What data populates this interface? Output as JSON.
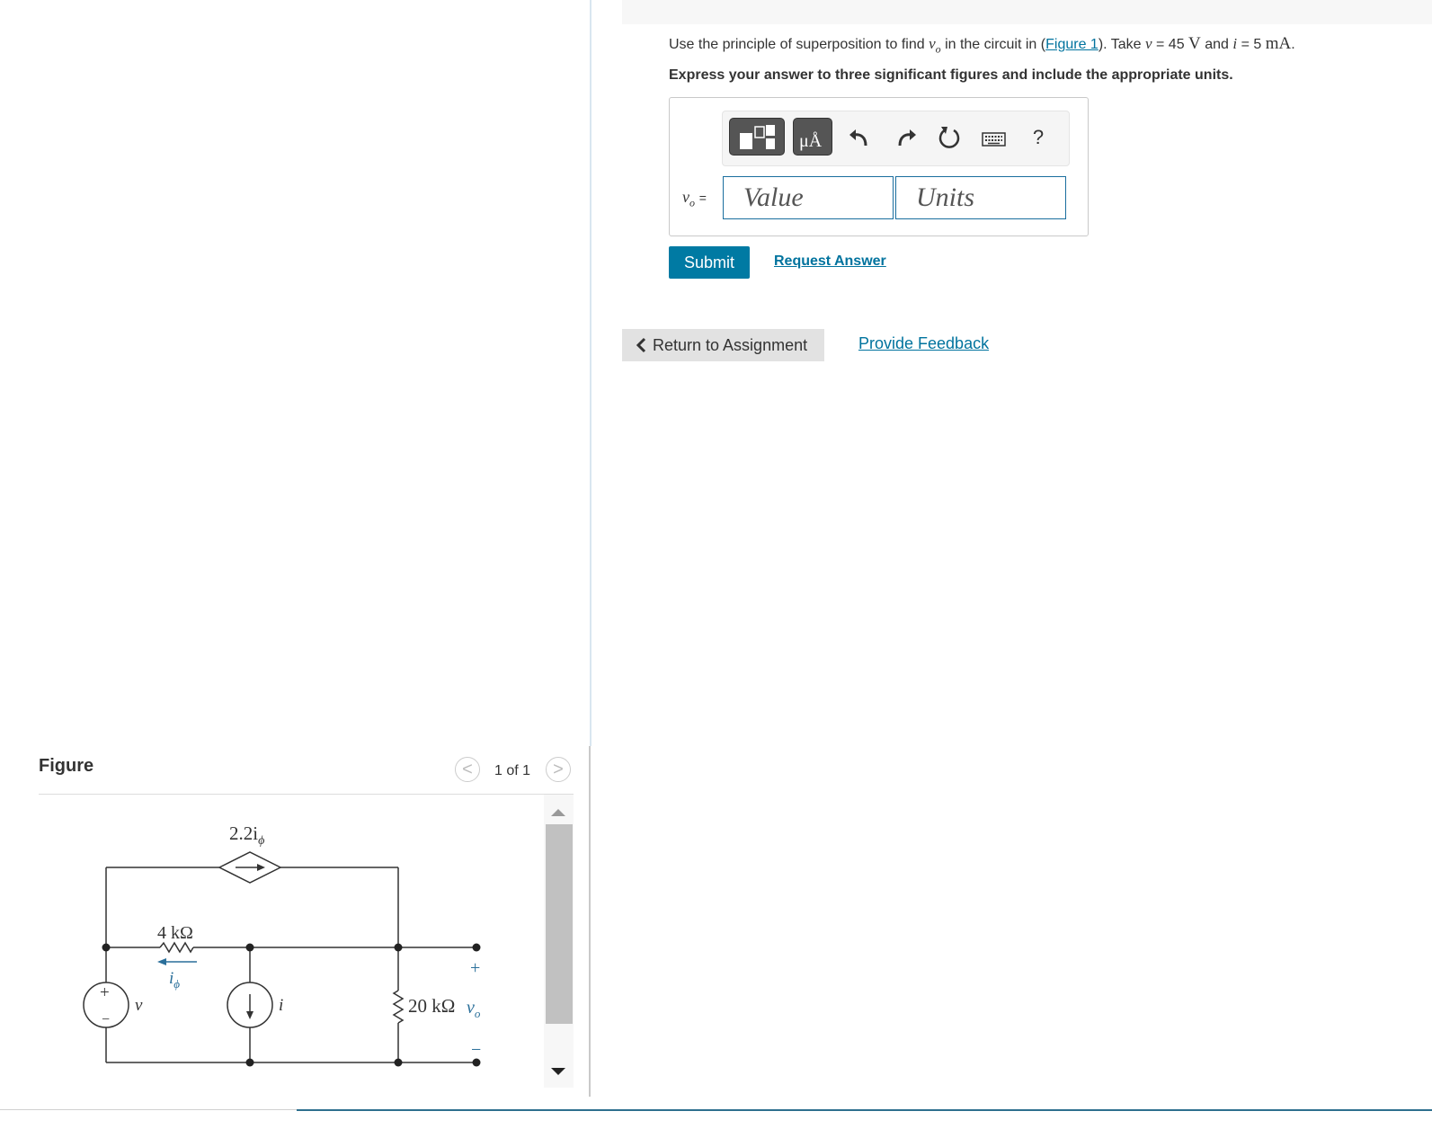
{
  "problem": {
    "prefix": "Use the principle of superposition to find",
    "var_vo": "v",
    "var_vo_sub": "o",
    "mid": "in the circuit in (",
    "figure_link": "Figure 1",
    "after_link": "). Take",
    "v_sym": "v",
    "v_eq": "= 45",
    "v_unit": "V",
    "and": "and",
    "i_sym": "i",
    "i_eq": "= 5",
    "i_unit": "mA",
    "end": "."
  },
  "instructions": "Express your answer to three significant figures and include the appropriate units.",
  "toolbar": {
    "units_label": "μÅ",
    "help_label": "?"
  },
  "answer": {
    "label_var": "v",
    "label_sub": "o",
    "label_eq": "=",
    "value_placeholder": "Value",
    "units_placeholder": "Units"
  },
  "buttons": {
    "submit": "Submit",
    "request_answer": "Request Answer",
    "return": "Return to Assignment",
    "feedback": "Provide Feedback"
  },
  "figure": {
    "title": "Figure",
    "pager": "1 of 1",
    "prev": "<",
    "next": ">",
    "labels": {
      "dep_source": "2.2i",
      "dep_source_sub": "ϕ",
      "r1": "4 kΩ",
      "i_phi": "i",
      "i_phi_sub": "ϕ",
      "v_source": "v",
      "i_source": "i",
      "r2": "20 kΩ",
      "vo": "v",
      "vo_sub": "o",
      "plus": "+",
      "minus": "−",
      "src_plus": "+",
      "src_minus": "−"
    }
  }
}
